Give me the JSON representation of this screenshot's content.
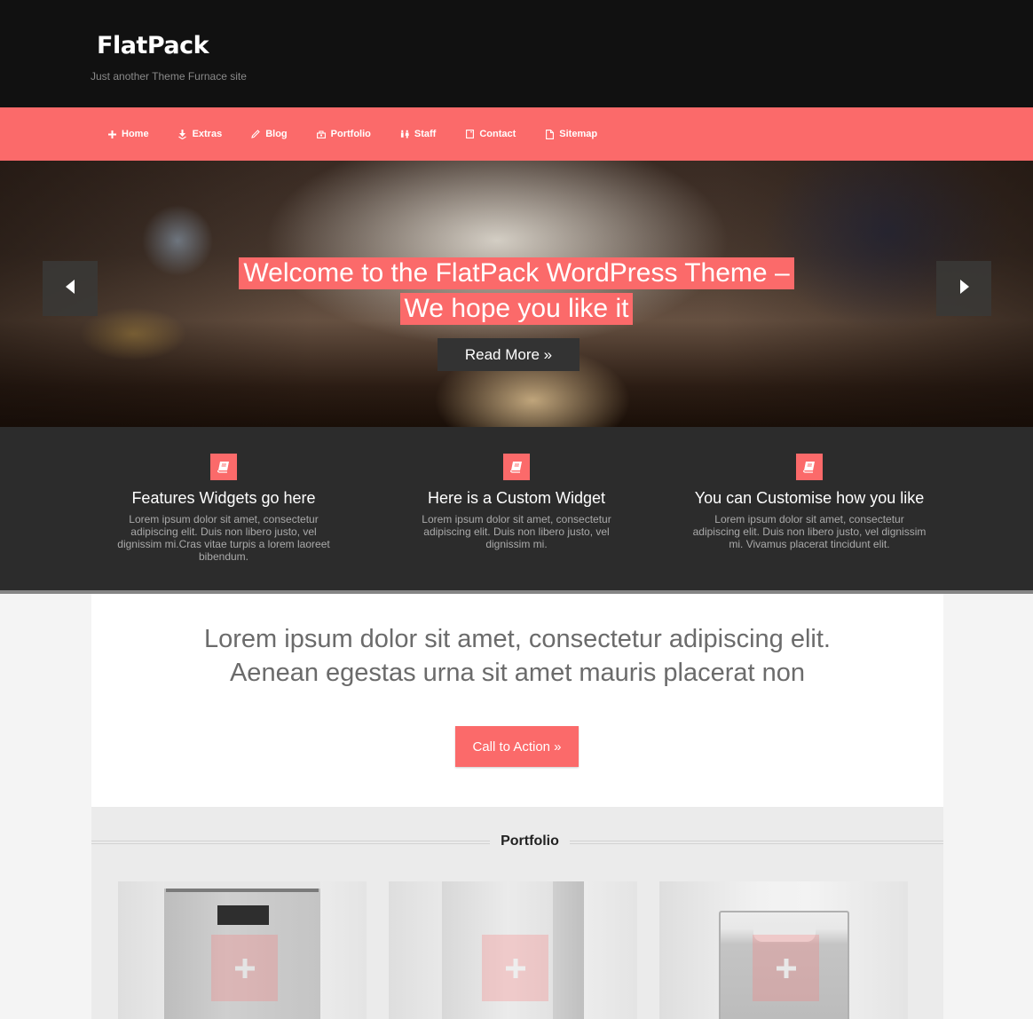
{
  "header": {
    "site_title": "FlatPack",
    "tagline": "Just another Theme Furnace site"
  },
  "nav": {
    "items": [
      {
        "label": "Home",
        "icon": "plus-icon"
      },
      {
        "label": "Extras",
        "icon": "download-icon"
      },
      {
        "label": "Blog",
        "icon": "pencil-icon"
      },
      {
        "label": "Portfolio",
        "icon": "briefcase-icon"
      },
      {
        "label": "Staff",
        "icon": "people-icon"
      },
      {
        "label": "Contact",
        "icon": "contact-card-icon"
      },
      {
        "label": "Sitemap",
        "icon": "document-icon"
      }
    ]
  },
  "hero": {
    "title_line1": "Welcome to the FlatPack WordPress Theme –",
    "title_line2": "We hope you like it",
    "read_more_label": "Read More »",
    "prev_icon": "arrow-left-icon",
    "next_icon": "arrow-right-icon"
  },
  "features": [
    {
      "icon": "book-icon",
      "title": "Features Widgets go here",
      "text": "Lorem ipsum dolor sit amet, consectetur adipiscing elit. Duis non libero justo, vel dignissim mi.Cras vitae turpis a lorem laoreet bibendum."
    },
    {
      "icon": "book-icon",
      "title": "Here is a Custom Widget",
      "text": "Lorem ipsum dolor sit amet, consectetur adipiscing elit. Duis non libero justo, vel dignissim mi."
    },
    {
      "icon": "book-icon",
      "title": "You can Customise how you like",
      "text": "Lorem ipsum dolor sit amet, consectetur adipiscing elit. Duis non libero justo, vel dignissim mi. Vivamus placerat tincidunt elit."
    }
  ],
  "intro": {
    "line1": "Lorem ipsum dolor sit amet, consectetur adipiscing elit.",
    "line2": "Aenean egestas urna sit amet mauris placerat non",
    "cta_label": "Call to Action »"
  },
  "portfolio": {
    "heading": "Portfolio",
    "items": [
      {
        "name": "cardboard box",
        "overlay_icon": "plus-icon"
      },
      {
        "name": "paper bag",
        "overlay_icon": "plus-icon"
      },
      {
        "name": "acrylic card holder",
        "overlay_icon": "plus-icon"
      }
    ]
  },
  "colors": {
    "accent": "#fb6a6a",
    "header_bg": "#111111",
    "features_bg": "#2c2c2c",
    "button_dark": "#333333"
  }
}
